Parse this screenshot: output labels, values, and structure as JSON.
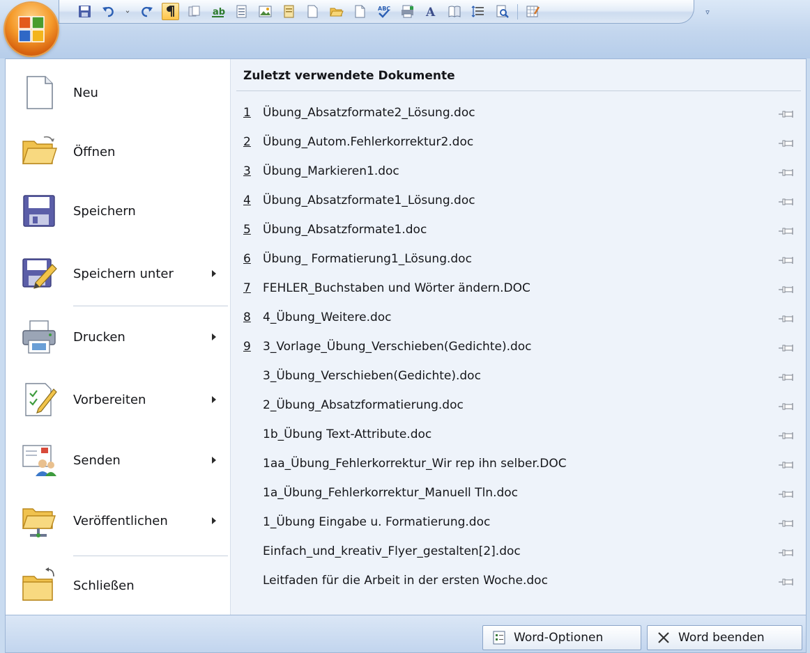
{
  "colors": {
    "accent": "#ffc54a",
    "panel": "#eef3fa",
    "frame": "#9eb6d6"
  },
  "qat": {
    "buttons": [
      {
        "name": "save-icon"
      },
      {
        "name": "undo-icon"
      },
      {
        "name": "undo-dropdown-icon"
      },
      {
        "name": "redo-icon"
      },
      {
        "name": "pilcrow-icon",
        "active": true
      },
      {
        "name": "copy-format-icon"
      },
      {
        "name": "text-highlight-icon"
      },
      {
        "name": "document-view-icon"
      },
      {
        "name": "picture-icon"
      },
      {
        "name": "page-list-icon"
      },
      {
        "name": "new-page-icon"
      },
      {
        "name": "open-folder-icon"
      },
      {
        "name": "new-document-icon"
      },
      {
        "name": "spelling-check-icon"
      },
      {
        "name": "print-layout-icon"
      },
      {
        "name": "font-a-icon"
      },
      {
        "name": "book-icon"
      },
      {
        "name": "line-spacing-icon"
      },
      {
        "name": "print-preview-icon"
      },
      {
        "name": "edit-table-icon"
      }
    ],
    "customize_glyph": "▿"
  },
  "menu": {
    "items": [
      {
        "label": "Neu",
        "icon": "new-document-icon",
        "has_submenu": false
      },
      {
        "label": "Öffnen",
        "icon": "open-folder-icon",
        "has_submenu": false
      },
      {
        "label": "Speichern",
        "icon": "save-disk-icon",
        "has_submenu": false
      },
      {
        "label": "Speichern unter",
        "icon": "save-as-icon",
        "has_submenu": true
      },
      {
        "label": "Drucken",
        "icon": "printer-icon",
        "has_submenu": true
      },
      {
        "label": "Vorbereiten",
        "icon": "prepare-document-icon",
        "has_submenu": true
      },
      {
        "label": "Senden",
        "icon": "send-people-icon",
        "has_submenu": true
      },
      {
        "label": "Veröffentlichen",
        "icon": "publish-folder-icon",
        "has_submenu": true
      },
      {
        "label": "Schließen",
        "icon": "close-folder-icon",
        "has_submenu": false
      }
    ]
  },
  "recent": {
    "title": "Zuletzt verwendete Dokumente",
    "documents": [
      {
        "num": "1",
        "name": "Übung_Absatzformate2_Lösung.doc"
      },
      {
        "num": "2",
        "name": "Übung_Autom.Fehlerkorrektur2.doc"
      },
      {
        "num": "3",
        "name": "Übung_Markieren1.doc"
      },
      {
        "num": "4",
        "name": "Übung_Absatzformate1_Lösung.doc"
      },
      {
        "num": "5",
        "name": "Übung_Absatzformate1.doc"
      },
      {
        "num": "6",
        "name": "Übung_ Formatierung1_Lösung.doc"
      },
      {
        "num": "7",
        "name": "FEHLER_Buchstaben und Wörter ändern.DOC"
      },
      {
        "num": "8",
        "name": "4_Übung_Weitere.doc"
      },
      {
        "num": "9",
        "name": "3_Vorlage_Übung_Verschieben(Gedichte).doc"
      },
      {
        "num": "",
        "name": "3_Übung_Verschieben(Gedichte).doc"
      },
      {
        "num": "",
        "name": "2_Übung_Absatzformatierung.doc"
      },
      {
        "num": "",
        "name": "1b_Übung Text-Attribute.doc"
      },
      {
        "num": "",
        "name": "1aa_Übung_Fehlerkorrektur_Wir rep ihn selber.DOC"
      },
      {
        "num": "",
        "name": "1a_Übung_Fehlerkorrektur_Manuell Tln.doc"
      },
      {
        "num": "",
        "name": "1_Übung Eingabe u. Formatierung.doc"
      },
      {
        "num": "",
        "name": "Einfach_und_kreativ_Flyer_gestalten[2].doc"
      },
      {
        "num": "",
        "name": "Leitfaden für die Arbeit in der ersten Woche.doc"
      }
    ]
  },
  "footer": {
    "options_label": "Word-Optionen",
    "exit_label": "Word beenden"
  }
}
